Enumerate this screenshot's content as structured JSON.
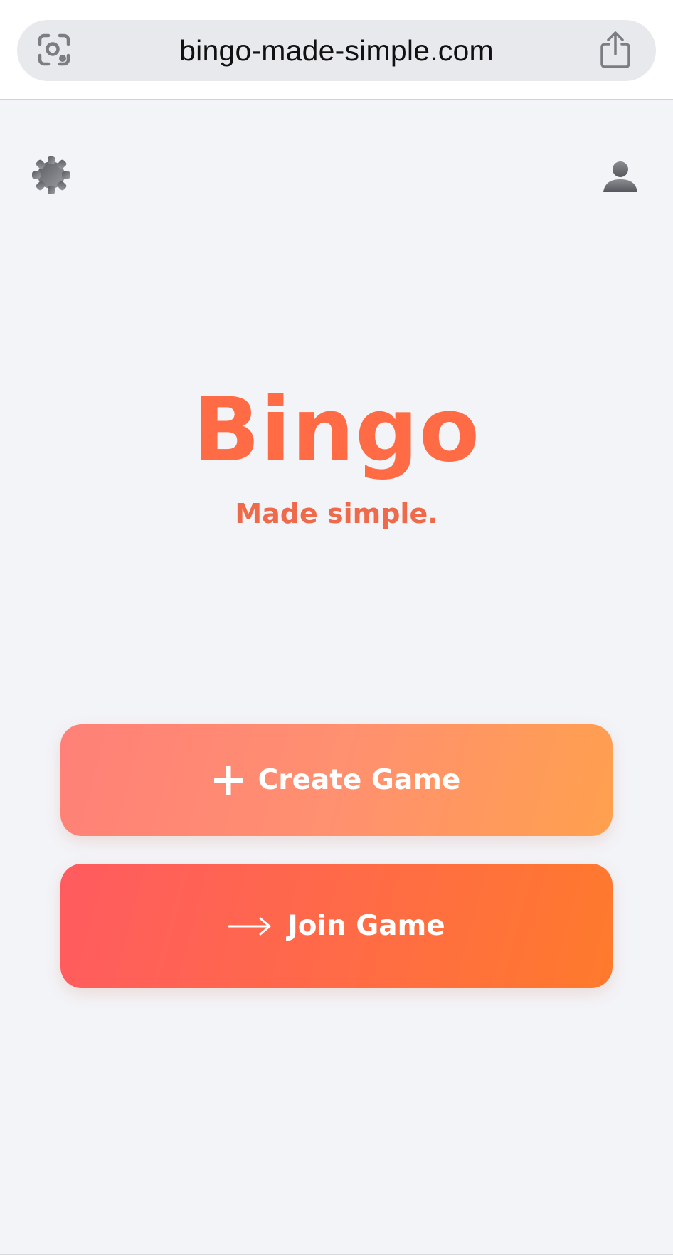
{
  "browser": {
    "url": "bingo-made-simple.com",
    "icons": {
      "left": "lens-icon",
      "right": "share-icon"
    }
  },
  "header": {
    "settings_icon": "gear-icon",
    "profile_icon": "user-icon"
  },
  "hero": {
    "title": "Bingo",
    "subtitle": "Made simple."
  },
  "actions": {
    "create": {
      "label": "Create Game",
      "icon": "plus-icon"
    },
    "join": {
      "label": "Join Game",
      "icon": "arrow-right-icon"
    }
  },
  "colors": {
    "brand": "#ff6b45",
    "background": "#f3f4f8",
    "create_gradient": [
      "#ff8078",
      "#ffa04e"
    ],
    "join_gradient": [
      "#ff5b60",
      "#ff7a2c"
    ]
  }
}
